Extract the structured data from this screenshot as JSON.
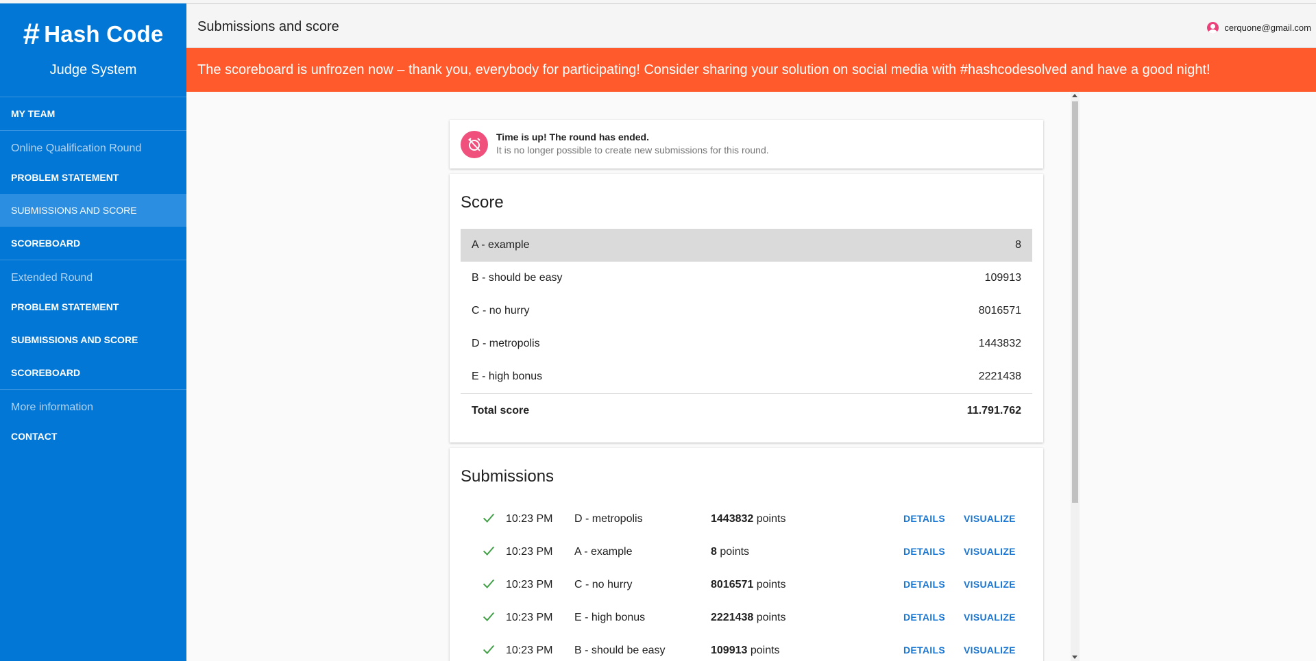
{
  "brand": {
    "symbol": "#",
    "title": "Hash Code",
    "subtitle": "Judge System"
  },
  "sidebar": {
    "my_team": "My Team",
    "sections": [
      {
        "header": "Online Qualification Round",
        "items": [
          "Problem Statement",
          "Submissions and Score",
          "Scoreboard"
        ]
      },
      {
        "header": "Extended Round",
        "items": [
          "Problem Statement",
          "Submissions and Score",
          "Scoreboard"
        ]
      },
      {
        "header": "More information",
        "items": [
          "Contact"
        ]
      }
    ]
  },
  "header": {
    "title": "Submissions and score",
    "user_email": "cerquone@gmail.com"
  },
  "banner": {
    "text": "The scoreboard is unfrozen now – thank you, everybody for participating! Consider sharing your solution on social media with #hashcodesolved and have a good night!",
    "color": "#ff5a2c"
  },
  "alert": {
    "title": "Time is up! The round has ended.",
    "message": "It is no longer possible to create new submissions for this round."
  },
  "score": {
    "title": "Score",
    "rows": [
      {
        "problem": "A - example",
        "value": "8"
      },
      {
        "problem": "B - should be easy",
        "value": "109913"
      },
      {
        "problem": "C - no hurry",
        "value": "8016571"
      },
      {
        "problem": "D - metropolis",
        "value": "1443832"
      },
      {
        "problem": "E - high bonus",
        "value": "2221438"
      }
    ],
    "total_label": "Total score",
    "total_value": "11.791.762"
  },
  "submissions": {
    "title": "Submissions",
    "points_suffix": "points",
    "details_label": "Details",
    "visualize_label": "Visualize",
    "rows": [
      {
        "time": "10:23 PM",
        "problem": "D - metropolis",
        "points": "1443832"
      },
      {
        "time": "10:23 PM",
        "problem": "A - example",
        "points": "8"
      },
      {
        "time": "10:23 PM",
        "problem": "C - no hurry",
        "points": "8016571"
      },
      {
        "time": "10:23 PM",
        "problem": "E - high bonus",
        "points": "2221438"
      },
      {
        "time": "10:23 PM",
        "problem": "B - should be easy",
        "points": "109913"
      }
    ]
  },
  "colors": {
    "sidebar": "#0277d6",
    "accent": "#1976d2",
    "check": "#43a047",
    "alert_icon": "#f0507c"
  }
}
